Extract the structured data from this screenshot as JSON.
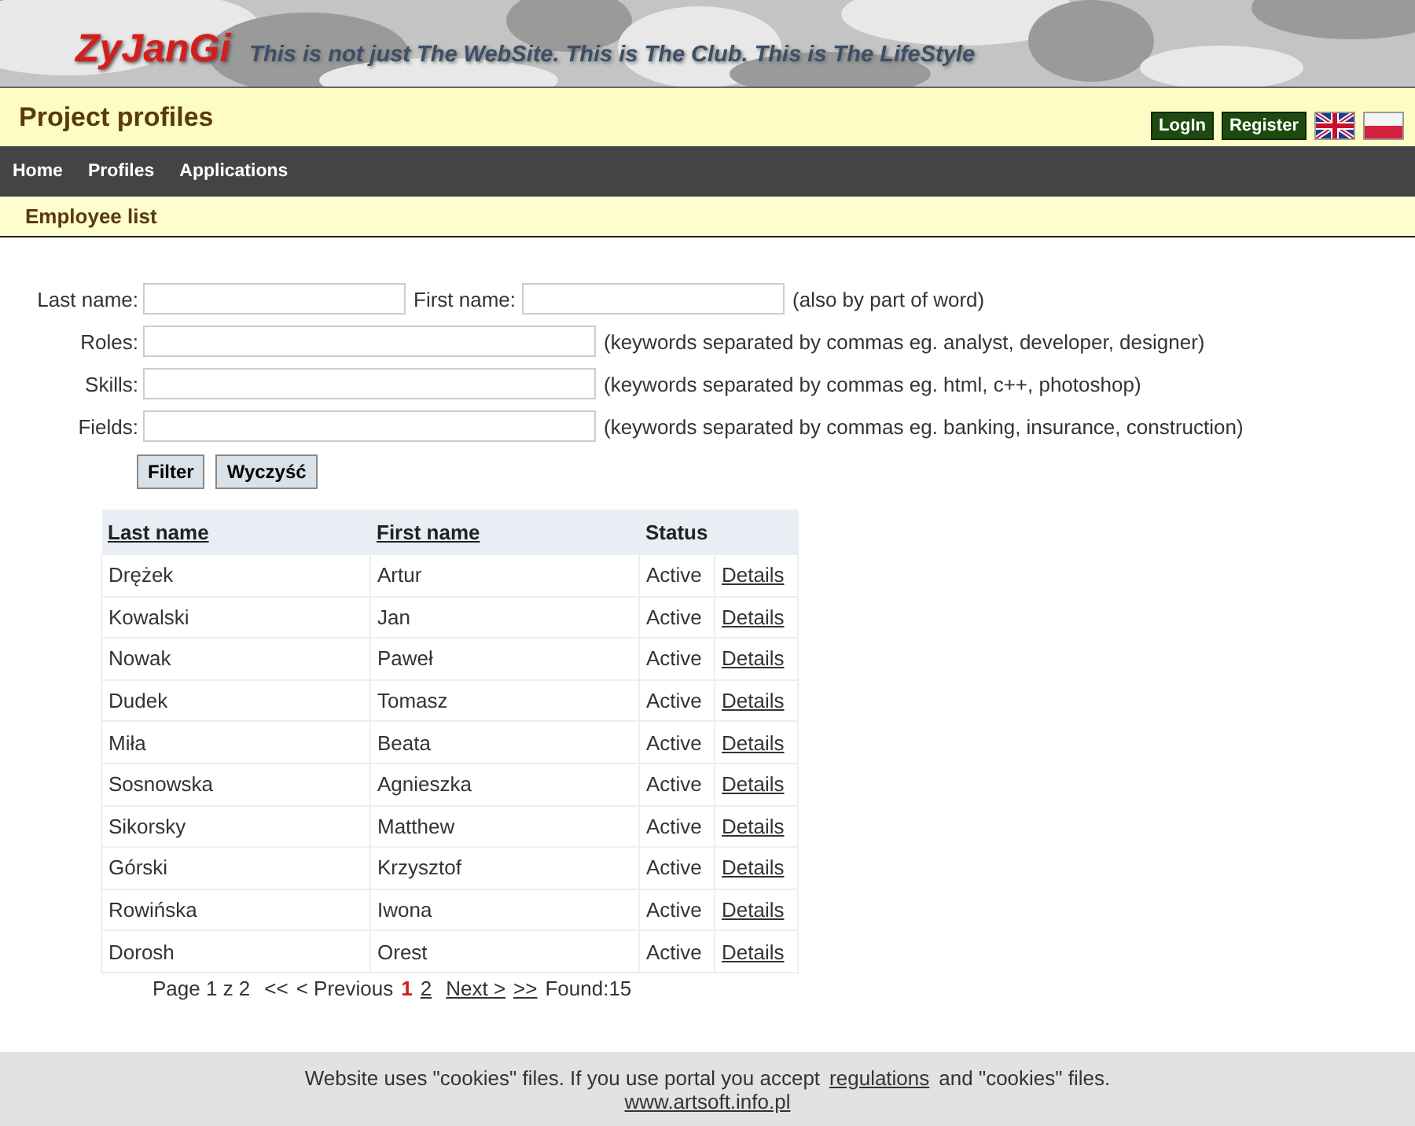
{
  "header": {
    "logo": "ZyJanGi",
    "tagline": "This is not just The WebSite. This is The Club. This is The LifeStyle"
  },
  "title_bar": {
    "title": "Project profiles",
    "buttons": [
      "LogIn",
      "Register"
    ],
    "languages": [
      {
        "kind": "uk"
      },
      {
        "kind": "pl"
      }
    ]
  },
  "nav": [
    "Home",
    "Profiles",
    "Applications"
  ],
  "breadcrumb": "Employee list",
  "filters": [
    {
      "label": "Last name:",
      "kind": "short",
      "second_label": "First name:",
      "second_hint": "(also by part of word)"
    },
    {
      "label": "Roles:",
      "kind": "long",
      "hint": "(keywords separated by commas eg. analyst, developer, designer)"
    },
    {
      "label": "Skills:",
      "kind": "long",
      "hint": "(keywords separated by commas eg. html, c++, photoshop)"
    },
    {
      "label": "Fields:",
      "kind": "long",
      "hint": "(keywords separated by commas eg. banking, insurance, construction)"
    }
  ],
  "filter_buttons": [
    "Filter",
    "Wyczyść"
  ],
  "table": {
    "columns": [
      {
        "label": "Last name",
        "sortable": true
      },
      {
        "label": "First name",
        "sortable": true
      },
      {
        "label": "Status",
        "sortable": false
      }
    ],
    "rows": [
      {
        "last": "Drężek",
        "first": "Artur",
        "status": "Active",
        "action": "Details"
      },
      {
        "last": "Kowalski",
        "first": "Jan",
        "status": "Active",
        "action": "Details"
      },
      {
        "last": "Nowak",
        "first": "Paweł",
        "status": "Active",
        "action": "Details"
      },
      {
        "last": "Dudek",
        "first": "Tomasz",
        "status": "Active",
        "action": "Details"
      },
      {
        "last": "Miła",
        "first": "Beata",
        "status": "Active",
        "action": "Details"
      },
      {
        "last": "Sosnowska",
        "first": "Agnieszka",
        "status": "Active",
        "action": "Details"
      },
      {
        "last": "Sikorsky",
        "first": "Matthew",
        "status": "Active",
        "action": "Details"
      },
      {
        "last": "Górski",
        "first": "Krzysztof",
        "status": "Active",
        "action": "Details"
      },
      {
        "last": "Rowińska",
        "first": "Iwona",
        "status": "Active",
        "action": "Details"
      },
      {
        "last": "Dorosh",
        "first": "Orest",
        "status": "Active",
        "action": "Details"
      }
    ]
  },
  "pagination": {
    "info": "Page 1 z 2",
    "first": "<<",
    "previous": "< Previous",
    "pages": [
      {
        "label": "1",
        "selected": true
      },
      {
        "label": "2",
        "selected": false
      }
    ],
    "next": "Next >",
    "last": ">>",
    "found": "Found:15"
  },
  "cookie_bar": {
    "text_before": "Website uses \"cookies\" files. If you use portal you accept",
    "link": "regulations",
    "text_after": "and \"cookies\" files.",
    "site_link": "www.artsoft.info.pl"
  }
}
